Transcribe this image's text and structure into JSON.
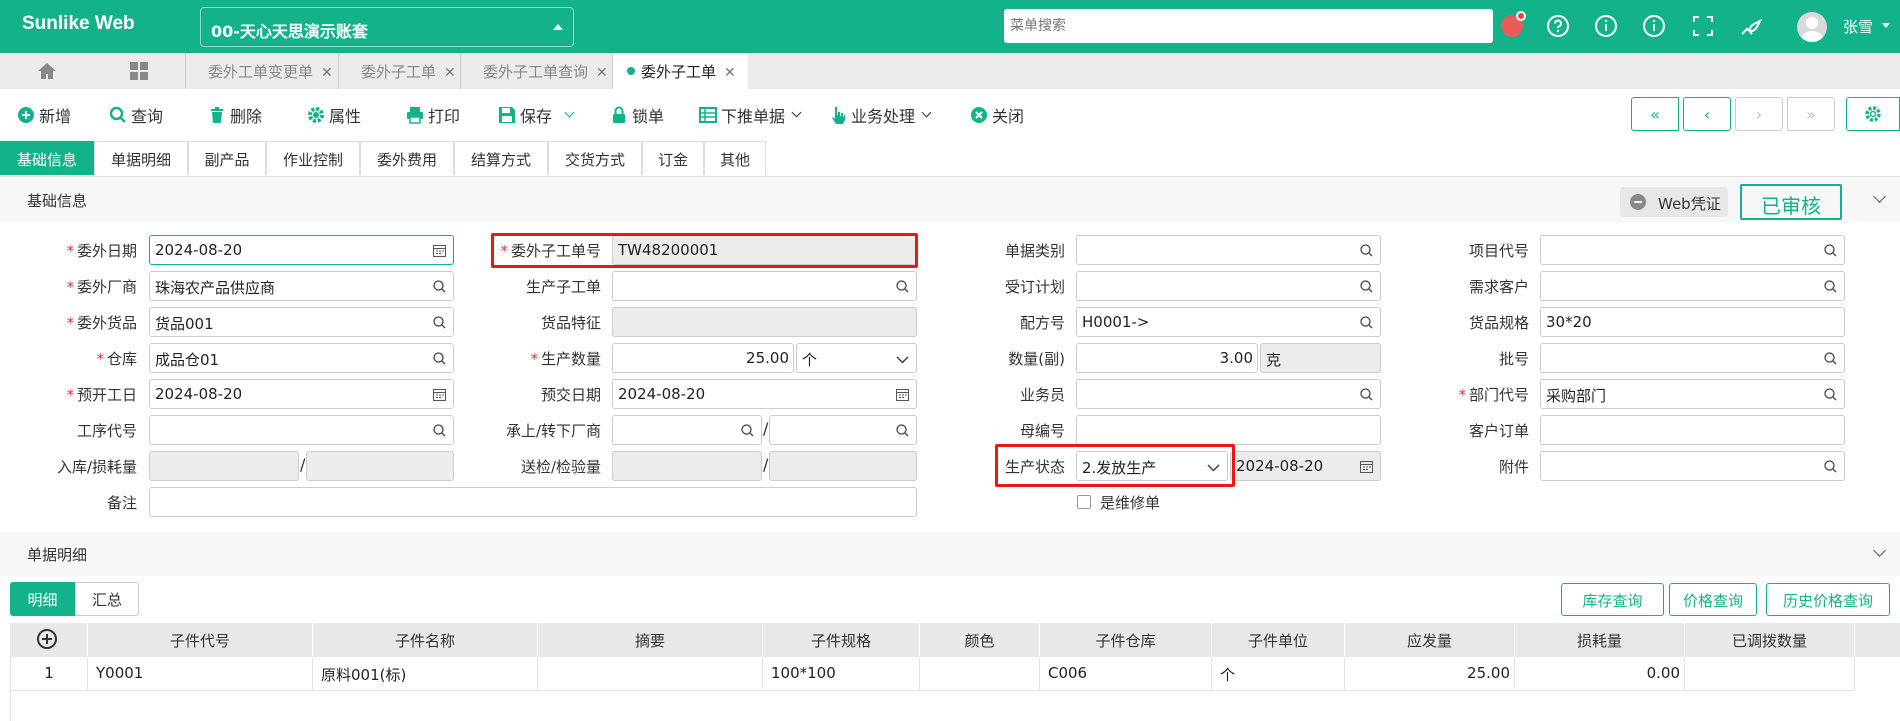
{
  "header": {
    "brand": "Sunlike Web",
    "account": "00-天心天思演示账套",
    "search_placeholder": "菜单搜索",
    "user": "张雪"
  },
  "tabs": [
    {
      "label": "委外工单变更单"
    },
    {
      "label": "委外子工单"
    },
    {
      "label": "委外子工单查询"
    },
    {
      "label": "委外子工单"
    }
  ],
  "toolbar": {
    "add": "新增",
    "query": "查询",
    "delete": "删除",
    "props": "属性",
    "print": "打印",
    "save": "保存",
    "lock": "锁单",
    "push": "下推单据",
    "biz": "业务处理",
    "close": "关闭"
  },
  "subtabs": [
    "基础信息",
    "单据明细",
    "副产品",
    "作业控制",
    "委外费用",
    "结算方式",
    "交货方式",
    "订金",
    "其他"
  ],
  "basic": {
    "title": "基础信息",
    "web_voucher": "Web凭证",
    "status_stamp": "已审核"
  },
  "form": {
    "out_date_label": "委外日期",
    "out_date": "2024-08-20",
    "order_no_label": "委外子工单号",
    "order_no": "TW48200001",
    "doc_type_label": "单据类别",
    "doc_type": "",
    "project_label": "项目代号",
    "project": "",
    "vendor_label": "委外厂商",
    "vendor": "珠海农产品供应商",
    "prod_order_label": "生产子工单",
    "prod_order": "",
    "so_plan_label": "受订计划",
    "so_plan": "",
    "demand_cust_label": "需求客户",
    "demand_cust": "",
    "goods_label": "委外货品",
    "goods": "货品001",
    "feature_label": "货品特征",
    "feature": "",
    "formula_label": "配方号",
    "formula": "H0001->",
    "spec_label": "货品规格",
    "spec": "30*20",
    "wh_label": "仓库",
    "wh": "成品仓01",
    "qty_label": "生产数量",
    "qty": "25.00",
    "qty_unit": "个",
    "qty2_label": "数量(副)",
    "qty2": "3.00",
    "qty2_unit": "克",
    "batch_label": "批号",
    "batch": "",
    "start_label": "预开工日",
    "start": "2024-08-20",
    "due_label": "预交日期",
    "due": "2024-08-20",
    "sales_label": "业务员",
    "sales": "",
    "dept_label": "部门代号",
    "dept": "采购部门",
    "proc_label": "工序代号",
    "proc": "",
    "sub_vendor_label": "承上/转下厂商",
    "sub_vendor_a": "",
    "sub_vendor_b": "",
    "parent_label": "母编号",
    "parent": "",
    "cust_order_label": "客户订单",
    "cust_order": "",
    "inout_label": "入库/损耗量",
    "inout_a": "",
    "inout_b": "",
    "inspect_label": "送检/检验量",
    "inspect_a": "",
    "inspect_b": "",
    "prod_status_label": "生产状态",
    "prod_status": "2.发放生产",
    "prod_status_date": "2024-08-20",
    "attach_label": "附件",
    "attach": "",
    "repair_label": "是维修单",
    "remark_label": "备注",
    "remark": "",
    "slash": "/"
  },
  "detail": {
    "title": "单据明细",
    "tab_detail": "明细",
    "tab_summary": "汇总",
    "btn_stock": "库存查询",
    "btn_price": "价格查询",
    "btn_hist": "历史价格查询",
    "columns": [
      "子件代号",
      "子件名称",
      "摘要",
      "子件规格",
      "颜色",
      "子件仓库",
      "子件单位",
      "应发量",
      "损耗量",
      "已调拨数量"
    ],
    "rows": [
      {
        "idx": "1",
        "code": "Y0001",
        "name": "原料001(标)",
        "memo": "",
        "spec": "100*100",
        "color": "",
        "wh": "C006",
        "unit": "个",
        "qty": "25.00",
        "loss": "0.00",
        "moved": ""
      }
    ]
  },
  "colors": {
    "accent": "#13b28a",
    "highlight": "#e81818"
  }
}
